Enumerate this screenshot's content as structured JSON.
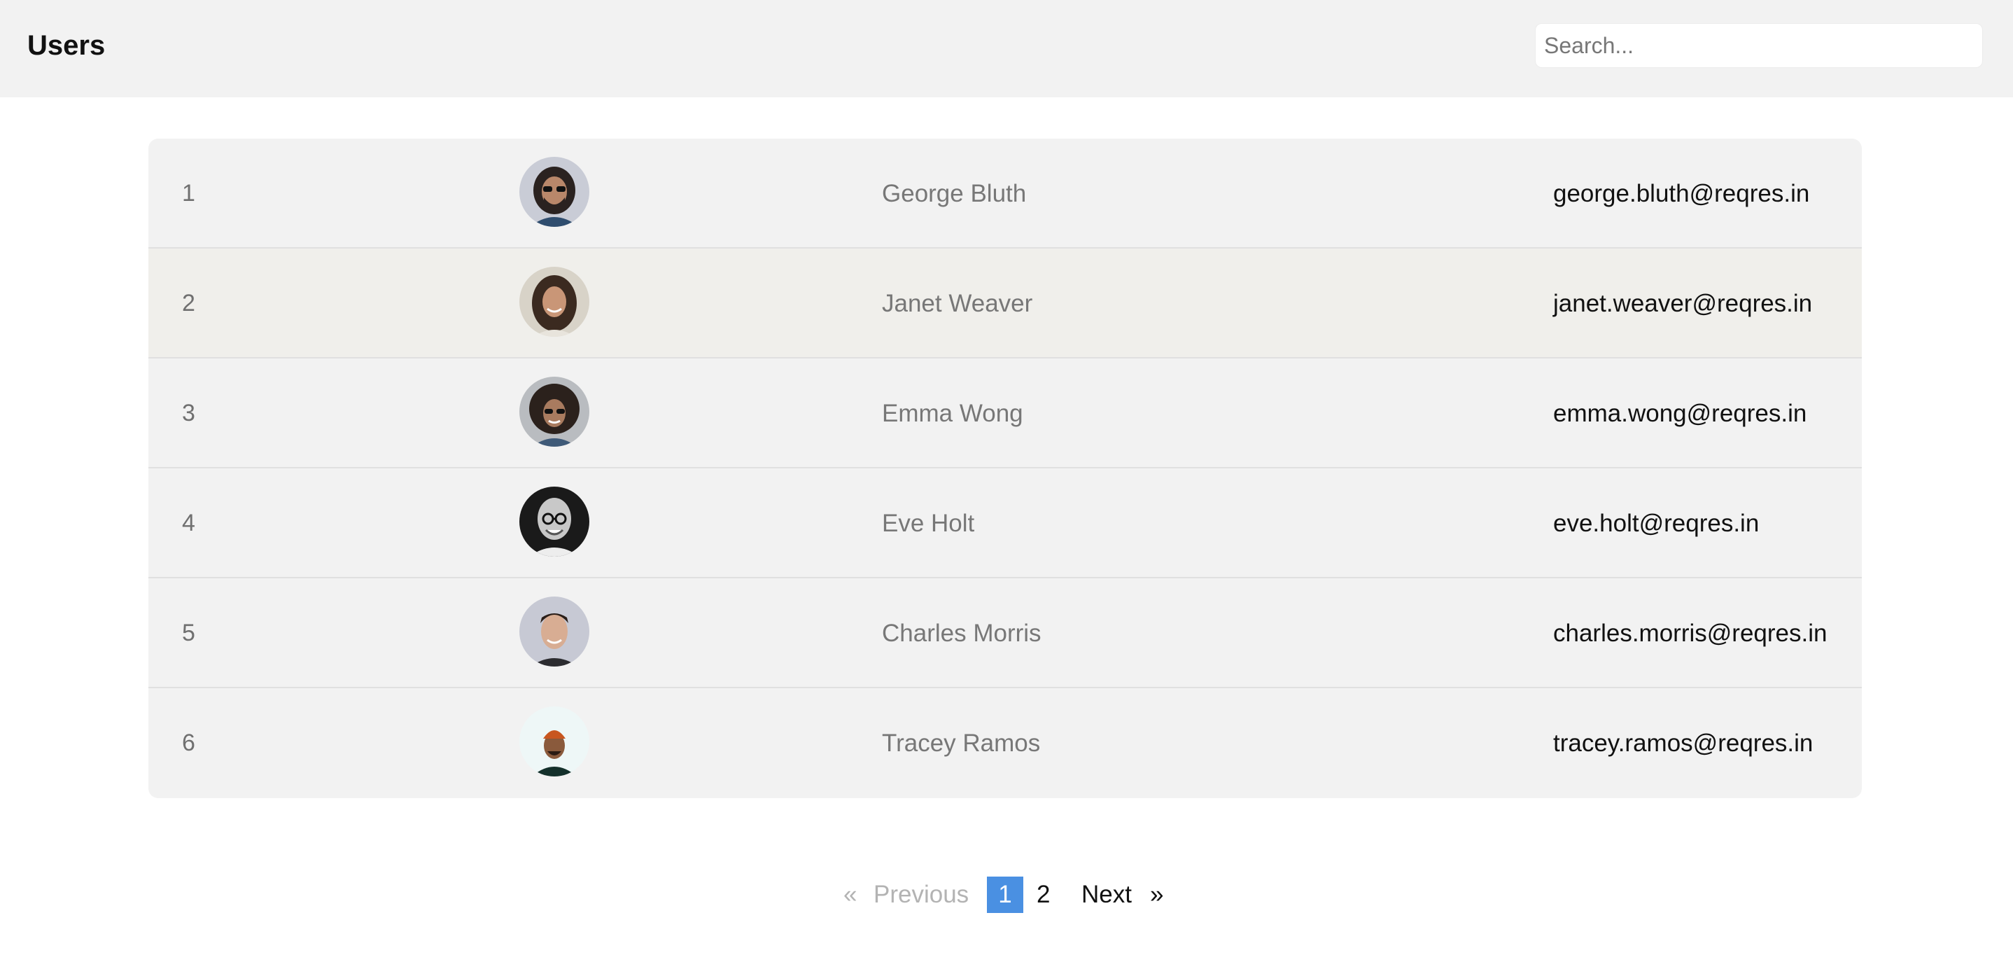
{
  "header": {
    "title": "Users",
    "search_placeholder": "Search..."
  },
  "users": [
    {
      "id": "1",
      "name": "George Bluth",
      "email": "george.bluth@reqres.in",
      "avatar_icon": "avatar-photo-george"
    },
    {
      "id": "2",
      "name": "Janet Weaver",
      "email": "janet.weaver@reqres.in",
      "avatar_icon": "avatar-photo-janet"
    },
    {
      "id": "3",
      "name": "Emma Wong",
      "email": "emma.wong@reqres.in",
      "avatar_icon": "avatar-photo-emma"
    },
    {
      "id": "4",
      "name": "Eve Holt",
      "email": "eve.holt@reqres.in",
      "avatar_icon": "avatar-photo-eve"
    },
    {
      "id": "5",
      "name": "Charles Morris",
      "email": "charles.morris@reqres.in",
      "avatar_icon": "avatar-photo-charles"
    },
    {
      "id": "6",
      "name": "Tracey Ramos",
      "email": "tracey.ramos@reqres.in",
      "avatar_icon": "avatar-photo-tracey"
    }
  ],
  "pagination": {
    "first": "«",
    "previous": "Previous",
    "pages": [
      "1",
      "2"
    ],
    "current_page": "1",
    "next": "Next",
    "last": "»"
  },
  "colors": {
    "header_bg": "#f2f2f2",
    "table_bg": "#f2f2f2",
    "row_highlight_bg": "#f0efeb",
    "active_page": "#4a90e2",
    "muted_text": "#777777",
    "disabled_text": "#b3b3b3"
  }
}
